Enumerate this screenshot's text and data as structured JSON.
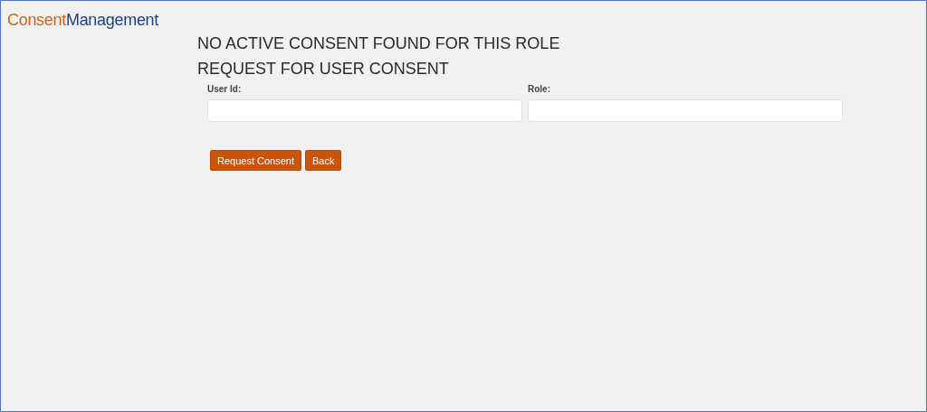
{
  "brand": {
    "first": "Consent",
    "second": "Management"
  },
  "headings": [
    "NO ACTIVE CONSENT FOUND FOR THIS ROLE",
    "REQUEST FOR USER CONSENT"
  ],
  "fields": [
    {
      "label": "User Id:"
    },
    {
      "label": "Role:"
    }
  ],
  "buttons": [
    "Request Consent",
    "Back"
  ]
}
